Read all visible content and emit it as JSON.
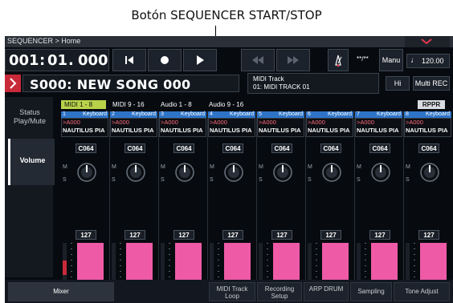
{
  "caption": "Botón SEQUENCER START/STOP",
  "breadcrumb": "SEQUENCER > Home",
  "locator": {
    "measure": "001",
    "sep1": ":",
    "beat": "01",
    "sep2": ".",
    "tick": "000"
  },
  "transport": {
    "rewind_icon": "locate-start-icon",
    "record_icon": "record-icon",
    "play_icon": "play-icon",
    "rew_icon": "rewind-icon",
    "ff_icon": "fast-forward-icon",
    "metronome_icon": "metronome-icon"
  },
  "meter": "**/**",
  "manual_label": "Manu",
  "tempo": {
    "note_icon": "quarter-note-icon",
    "value": "120.00"
  },
  "song": {
    "name": "S000: NEW SONG 000"
  },
  "midi_track": {
    "line1": "MIDI Track",
    "line2": "01: MIDI TRACK 01"
  },
  "hi_label": "Hi",
  "multi_rec_label": "Multi REC",
  "sidebar": {
    "items": [
      {
        "label": "Status Play/Mute"
      },
      {
        "label": "Volume"
      }
    ]
  },
  "tabs": [
    {
      "label": "MIDI 1 - 8"
    },
    {
      "label": "MIDI 9 - 16"
    },
    {
      "label": "Audio 1 - 8"
    },
    {
      "label": "Audio 9 - 16"
    }
  ],
  "rppr_label": "RPPR",
  "channels": [
    {
      "num": "1",
      "type": "Keyboard",
      "bank": ">A000",
      "program": "NAUTILUS PIA",
      "pan": "C064",
      "volume": "127",
      "level": 1.0
    },
    {
      "num": "2",
      "type": "Keyboard",
      "bank": ">A000",
      "program": "NAUTILUS PIA",
      "pan": "C064",
      "volume": "127",
      "level": 1.0
    },
    {
      "num": "3",
      "type": "Keyboard",
      "bank": ">A000",
      "program": "NAUTILUS PIA",
      "pan": "C064",
      "volume": "127",
      "level": 1.0
    },
    {
      "num": "4",
      "type": "Keyboard",
      "bank": ">A000",
      "program": "NAUTILUS PIA",
      "pan": "C064",
      "volume": "127",
      "level": 1.0
    },
    {
      "num": "5",
      "type": "Keyboard",
      "bank": ">A000",
      "program": "NAUTILUS PIA",
      "pan": "C064",
      "volume": "127",
      "level": 1.0
    },
    {
      "num": "6",
      "type": "Keyboard",
      "bank": ">A000",
      "program": "NAUTILUS PIA",
      "pan": "C064",
      "volume": "127",
      "level": 1.0
    },
    {
      "num": "7",
      "type": "Keyboard",
      "bank": ">A000",
      "program": "NAUTILUS PIA",
      "pan": "C064",
      "volume": "127",
      "level": 1.0
    },
    {
      "num": "8",
      "type": "Keyboard",
      "bank": ">A000",
      "program": "NAUTILUS PIA",
      "pan": "C064",
      "volume": "127",
      "level": 1.0
    }
  ],
  "ms": {
    "m": "M",
    "s": "S"
  },
  "bottom_tabs": [
    {
      "label": "Mixer"
    },
    {
      "label": "MIDI Track Loop"
    },
    {
      "label": "Recording Setup"
    },
    {
      "label": "ARP DRUM"
    },
    {
      "label": "Sampling"
    },
    {
      "label": "Tone Adjust"
    }
  ],
  "colors": {
    "accent_pink": "#ee5aa6",
    "tab_green": "#b9d24a",
    "channel_blue": "#2d74c7",
    "song_red": "#c92a3a"
  }
}
